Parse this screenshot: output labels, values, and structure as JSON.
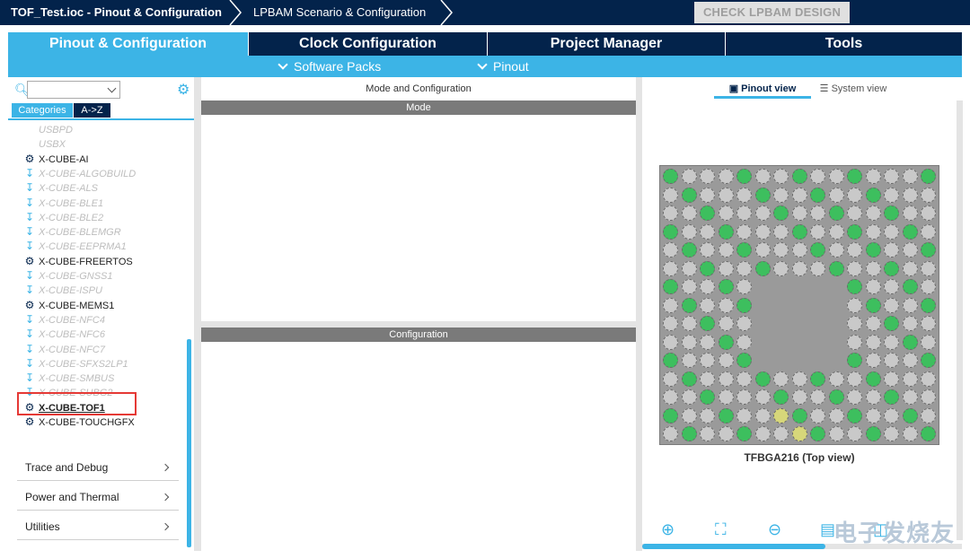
{
  "breadcrumb": {
    "file": "TOF_Test.ioc - Pinout & Configuration",
    "scenario": "LPBAM Scenario & Configuration",
    "check_button": "CHECK LPBAM DESIGN"
  },
  "tabs": [
    "Pinout & Configuration",
    "Clock Configuration",
    "Project Manager",
    "Tools"
  ],
  "subnav": {
    "software_packs": "Software Packs",
    "pinout": "Pinout"
  },
  "left": {
    "categories_tab": "Categories",
    "az_tab": "A->Z",
    "items": [
      {
        "label": "USBPD",
        "state": "disabled"
      },
      {
        "label": "USBX",
        "state": "disabled"
      },
      {
        "label": "X-CUBE-AI",
        "state": "active"
      },
      {
        "label": "X-CUBE-ALGOBUILD",
        "state": "disabled"
      },
      {
        "label": "X-CUBE-ALS",
        "state": "disabled"
      },
      {
        "label": "X-CUBE-BLE1",
        "state": "disabled"
      },
      {
        "label": "X-CUBE-BLE2",
        "state": "disabled"
      },
      {
        "label": "X-CUBE-BLEMGR",
        "state": "disabled"
      },
      {
        "label": "X-CUBE-EEPRMA1",
        "state": "disabled"
      },
      {
        "label": "X-CUBE-FREERTOS",
        "state": "active"
      },
      {
        "label": "X-CUBE-GNSS1",
        "state": "disabled"
      },
      {
        "label": "X-CUBE-ISPU",
        "state": "disabled"
      },
      {
        "label": "X-CUBE-MEMS1",
        "state": "active"
      },
      {
        "label": "X-CUBE-NFC4",
        "state": "disabled"
      },
      {
        "label": "X-CUBE-NFC6",
        "state": "disabled"
      },
      {
        "label": "X-CUBE-NFC7",
        "state": "disabled"
      },
      {
        "label": "X-CUBE-SFXS2LP1",
        "state": "disabled"
      },
      {
        "label": "X-CUBE-SMBUS",
        "state": "disabled"
      },
      {
        "label": "X-CUBE-SUBG2",
        "state": "disabled"
      },
      {
        "label": "X-CUBE-TOF1",
        "state": "active"
      },
      {
        "label": "X-CUBE-TOUCHGFX",
        "state": "active"
      }
    ],
    "sections": [
      "Trace and Debug",
      "Power and Thermal",
      "Utilities"
    ]
  },
  "middle": {
    "title": "Mode and Configuration",
    "mode_header": "Mode",
    "config_header": "Configuration"
  },
  "right": {
    "pinout_view_tab": "Pinout view",
    "system_view_tab": "System view",
    "chip_label": "TFBGA216 (Top view)",
    "toolbar": [
      "zoom-in-icon",
      "fit-screen-icon",
      "zoom-out-icon",
      "export-icon",
      "split-icon"
    ]
  },
  "watermark": "电子发烧友",
  "colors": {
    "navy": "#03234b",
    "accent": "#3cb4e6",
    "pin_green": "#3dbf5e",
    "pin_grey": "#c9c9c9",
    "pin_yellow": "#d7d77a",
    "highlight": "#e53935"
  }
}
